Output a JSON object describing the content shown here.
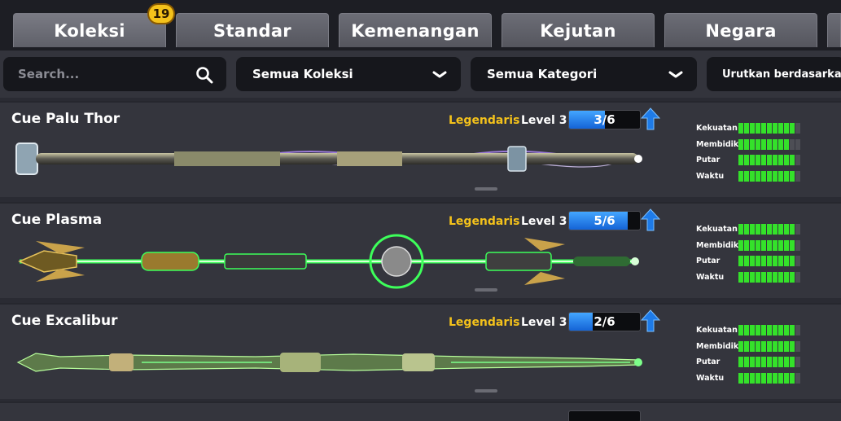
{
  "tabs": [
    {
      "label": "Koleksi",
      "active": true
    },
    {
      "label": "Standar",
      "active": false
    },
    {
      "label": "Kemenangan",
      "active": false
    },
    {
      "label": "Kejutan",
      "active": false
    },
    {
      "label": "Negara",
      "active": false
    }
  ],
  "badge_count": "19",
  "filters": {
    "search_placeholder": "Search...",
    "collection": "Semua Koleksi",
    "category": "Semua Kategori",
    "sort": "Urutkan berdasarkan"
  },
  "stat_labels": {
    "power": "Kekuatan",
    "aim": "Membidik",
    "spin": "Putar",
    "time": "Waktu"
  },
  "cues": [
    {
      "name": "Cue Palu Thor",
      "rarity": "Legendaris",
      "level": "Level 3",
      "progress_text": "3/6",
      "progress": 0.5,
      "stats": {
        "power": 10,
        "aim": 9,
        "spin": 10,
        "time": 10
      },
      "accent": "#b58cff"
    },
    {
      "name": "Cue Plasma",
      "rarity": "Legendaris",
      "level": "Level 3",
      "progress_text": "5/6",
      "progress": 0.83,
      "stats": {
        "power": 10,
        "aim": 10,
        "spin": 10,
        "time": 10
      },
      "accent": "#3dff5a"
    },
    {
      "name": "Cue Excalibur",
      "rarity": "Legendaris",
      "level": "Level 3",
      "progress_text": "2/6",
      "progress": 0.33,
      "stats": {
        "power": 10,
        "aim": 10,
        "spin": 10,
        "time": 10
      },
      "accent": "#7dff8a"
    }
  ],
  "colors": {
    "rarity": "#f4c21b",
    "progress": "#1e7be8",
    "stat_on": "#34e12a",
    "stat_off": "#4d4e55"
  }
}
